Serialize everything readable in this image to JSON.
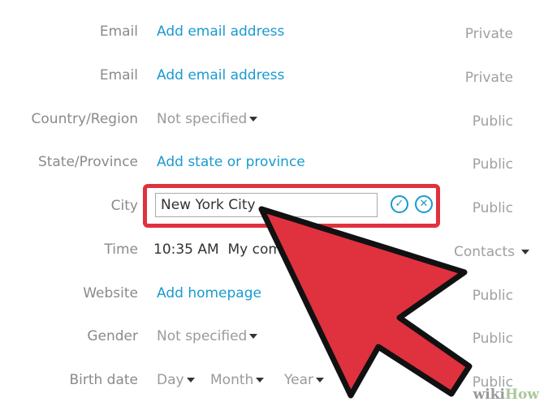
{
  "rows": [
    {
      "label": "Email",
      "value": "Add email address",
      "privacy": "Private"
    },
    {
      "label": "Email",
      "value": "Add email address",
      "privacy": "Private"
    },
    {
      "label": "Country/Region",
      "value": "Not specified",
      "privacy": "Public"
    },
    {
      "label": "State/Province",
      "value": "Add state or province",
      "privacy": "Public"
    },
    {
      "label": "City",
      "value": "New York City",
      "privacy": "Public"
    },
    {
      "label": "Time",
      "value": "10:35 AM",
      "value2": "My com",
      "privacy": "Contacts"
    },
    {
      "label": "Website",
      "value": "Add homepage",
      "privacy": "Public"
    },
    {
      "label": "Gender",
      "value": "Not specified",
      "privacy": "Public"
    },
    {
      "label": "Birth date",
      "day": "Day",
      "month": "Month",
      "year": "Year",
      "privacy": "Public"
    }
  ],
  "icons": {
    "confirm": "check-circle-icon",
    "cancel": "x-circle-icon",
    "arrow": "red-arrow-pointer"
  },
  "colors": {
    "link": "#1a9ad0",
    "highlight": "#e0313f"
  },
  "watermark": {
    "a": "wiki",
    "b": "How"
  }
}
